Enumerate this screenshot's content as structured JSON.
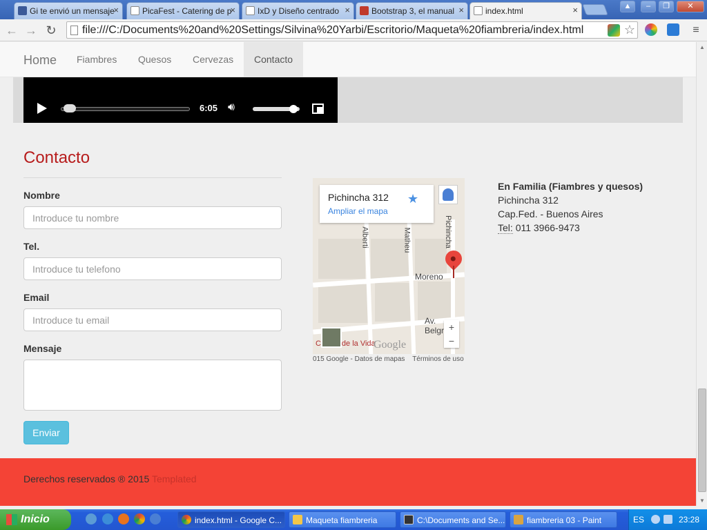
{
  "browser": {
    "tabs": [
      {
        "label": "Gi te envió un mensaje",
        "icon": "facebook-icon",
        "color": "#3b5998"
      },
      {
        "label": "PicaFest - Catering de p",
        "icon": "page-icon",
        "color": "#ffffff"
      },
      {
        "label": "IxD y Diseño centrado",
        "icon": "page-icon",
        "color": "#ffffff"
      },
      {
        "label": "Bootstrap 3, el manual",
        "icon": "book-icon",
        "color": "#c0392b"
      },
      {
        "label": "index.html",
        "icon": "page-icon",
        "color": "#ffffff"
      }
    ],
    "url": "file:///C:/Documents%20and%20Settings/Silvina%20Yarbi/Escritorio/Maqueta%20fiambreria/index.html"
  },
  "navbar": {
    "brand": "Home",
    "links": [
      "Fiambres",
      "Quesos",
      "Cervezas",
      "Contacto"
    ],
    "active": "Contacto"
  },
  "video": {
    "time": "6:05",
    "progress": 0.03,
    "volume": 0.95
  },
  "contact": {
    "title": "Contacto",
    "fields": [
      {
        "label": "Nombre",
        "placeholder": "Introduce tu nombre"
      },
      {
        "label": "Tel.",
        "placeholder": "Introduce tu telefono"
      },
      {
        "label": "Email",
        "placeholder": "Introduce tu email"
      },
      {
        "label": "Mensaje",
        "placeholder": ""
      }
    ],
    "submit": "Enviar"
  },
  "map": {
    "address": "Pichincha 312",
    "enlarge": "Ampliar el mapa",
    "streets": [
      "Alberti",
      "Matheu",
      "Pichincha",
      "Moreno",
      "Av. Belgrano",
      "Ciudad de la Vida"
    ],
    "footer_data": "015 Google - Datos de mapas",
    "footer_terms": "Términos de uso",
    "logo": "Google"
  },
  "address": {
    "name": "En Familia (Fiambres y quesos)",
    "street": "Pichincha 312",
    "city": "Cap.Fed. - Buenos Aires",
    "tel_label": "Tel:",
    "tel": "011 3966-9473"
  },
  "footer": {
    "text": "Derechos reservados ® 2015",
    "link": "Templated"
  },
  "taskbar": {
    "start": "Inicio",
    "windows": [
      {
        "label": "index.html - Google C...",
        "active": true
      },
      {
        "label": "Maqueta fiambreria",
        "active": false
      },
      {
        "label": "C:\\Documents and Se...",
        "active": false
      },
      {
        "label": "fiambreria 03 - Paint",
        "active": false
      }
    ],
    "lang": "ES",
    "clock": "23:28"
  }
}
